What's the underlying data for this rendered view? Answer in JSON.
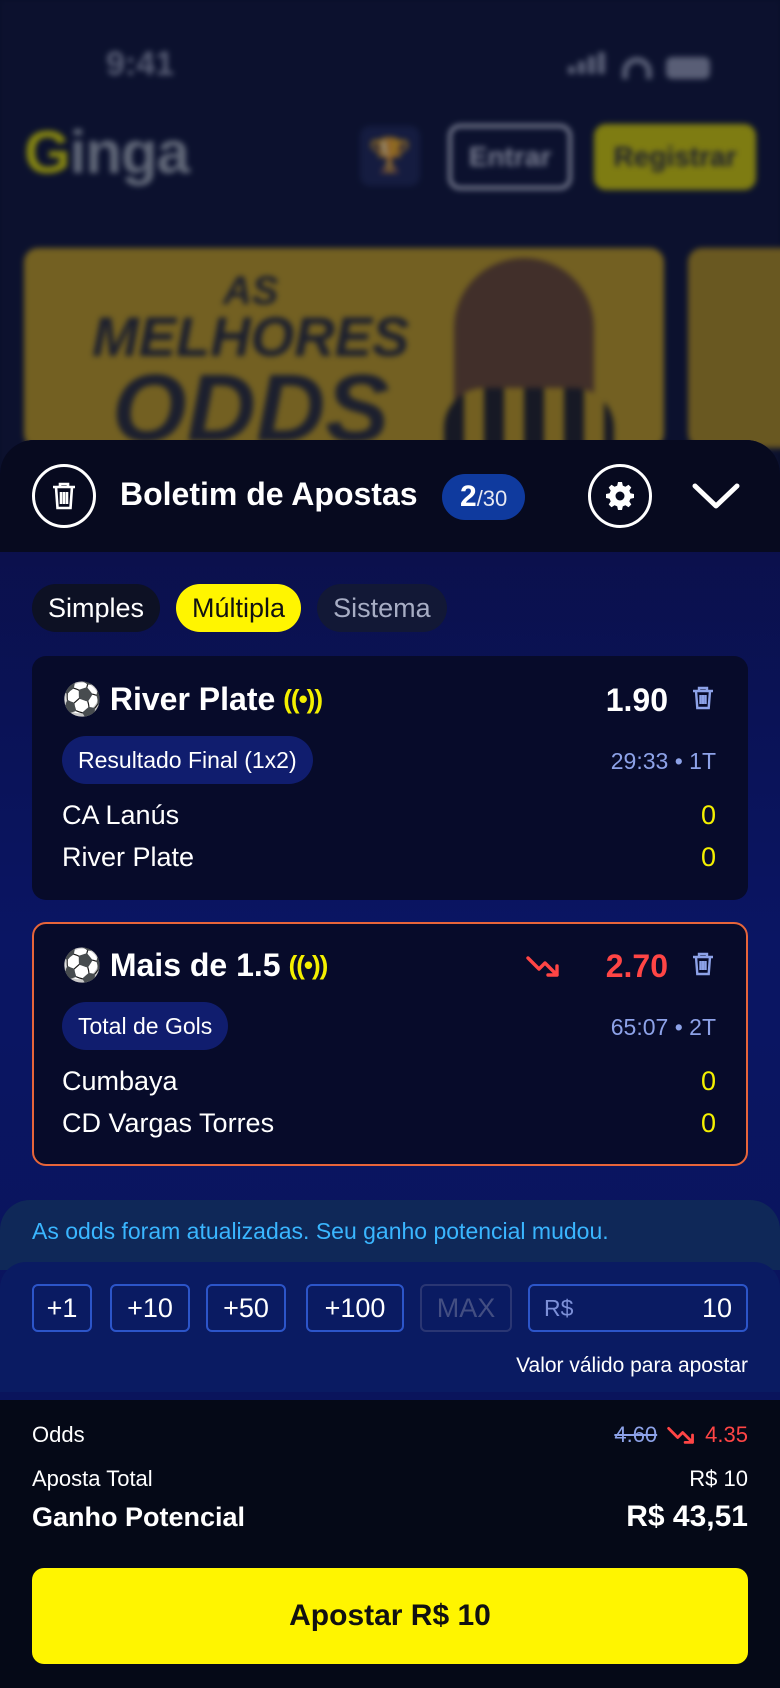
{
  "status": {
    "time": "9:41"
  },
  "background_page": {
    "logo": {
      "first": "G",
      "rest": "inga"
    },
    "login_label": "Entrar",
    "register_label": "Registrar",
    "banner": {
      "line1": "AS",
      "line2": "MELHORES",
      "line3": "ODDS"
    }
  },
  "betslip": {
    "title": "Boletim de Apostas",
    "count": {
      "current": "2",
      "max": "/30"
    },
    "tabs": [
      {
        "label": "Simples",
        "active": false
      },
      {
        "label": "Múltipla",
        "active": true
      },
      {
        "label": "Sistema",
        "active": false
      }
    ],
    "bets": [
      {
        "selection": "River Plate",
        "odd": "1.90",
        "market": "Resultado Final (1x2)",
        "clock": "29:33 • 1T",
        "teams": [
          {
            "name": "CA Lanús",
            "score": "0"
          },
          {
            "name": "River Plate",
            "score": "0"
          }
        ],
        "odd_changed": false
      },
      {
        "selection": "Mais de 1.5",
        "odd": "2.70",
        "market": "Total de Gols",
        "clock": "65:07 • 2T",
        "teams": [
          {
            "name": "Cumbaya",
            "score": "0"
          },
          {
            "name": "CD Vargas Torres",
            "score": "0"
          }
        ],
        "odd_changed": true
      }
    ],
    "notice": "As odds foram atualizadas. Seu ganho potencial mudou.",
    "quick_stakes": [
      "+1",
      "+10",
      "+50",
      "+100",
      "MAX"
    ],
    "stake": {
      "currency": "R$",
      "value": "10"
    },
    "stake_hint": "Valor válido para apostar",
    "summary": {
      "odds_label": "Odds",
      "old_odds": "4.60",
      "new_odds": "4.35",
      "total_label": "Aposta Total",
      "total_value": "R$ 10",
      "potential_label": "Ganho Potencial",
      "potential_value": "R$ 43,51"
    },
    "place_bet_label": "Apostar R$ 10"
  },
  "colors": {
    "accent_yellow": "#fff500",
    "odds_down_red": "#ff4545",
    "notice_blue": "#3ab6ff",
    "sheet_blue": "#0a1563"
  }
}
